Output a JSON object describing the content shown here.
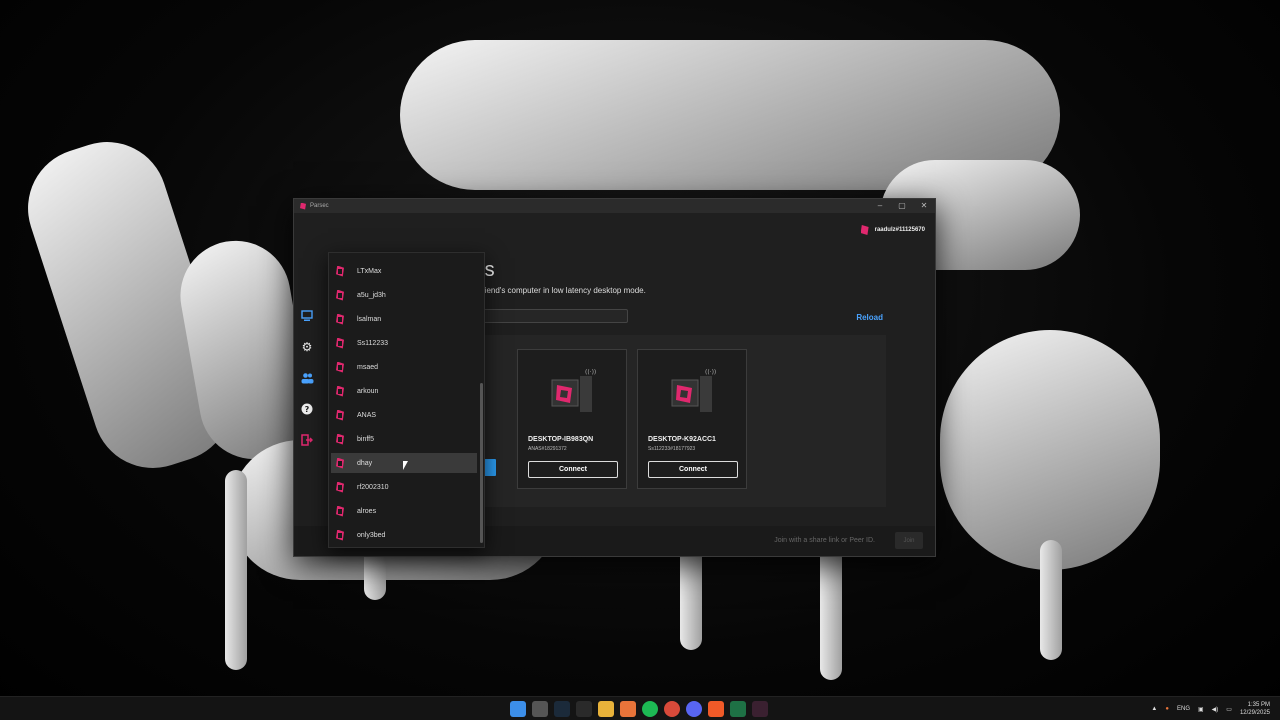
{
  "window": {
    "title": "Parsec",
    "controls": {
      "minimize": "–",
      "maximize": "▢",
      "close": "✕"
    }
  },
  "header": {
    "username": "raadulz#11125670"
  },
  "main": {
    "title_fragment": "rs",
    "subtitle_fragment": "riend's computer in low latency desktop mode.",
    "search_fragment": "h",
    "reload_label": "Reload"
  },
  "computers": [
    {
      "name": "DESKTOP-IB983QN",
      "peer": "ANAS#18291372",
      "button": "Connect"
    },
    {
      "name": "DESKTOP-K92ACC1",
      "peer": "Ss112233#18177923",
      "button": "Connect"
    }
  ],
  "footer": {
    "join_placeholder": "Join with a share link or Peer ID.",
    "join_button": "Join"
  },
  "dropdown": {
    "items": [
      "LTxMax",
      "a5u_jd3h",
      "lsalman",
      "Ss112233",
      "msaed",
      "arkoun",
      "ANAS",
      "binff5",
      "dhay",
      "rf2002310",
      "alroes",
      "only3bed"
    ],
    "hovered": "dhay"
  },
  "tray": {
    "language": "ENG",
    "time": "1:35 PM",
    "date": "12/29/2025"
  },
  "colors": {
    "accent": "#4aa3ff",
    "brand": "#e0286e"
  },
  "sidebar_icons": [
    "computer-icon",
    "gear-icon",
    "friends-icon",
    "help-icon",
    "logout-icon"
  ]
}
